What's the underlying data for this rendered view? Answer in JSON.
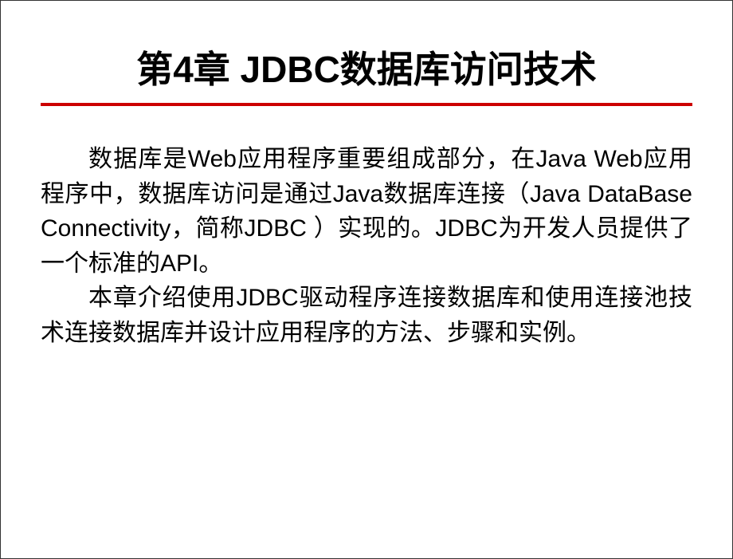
{
  "slide": {
    "title": "第4章  JDBC数据库访问技术",
    "paragraph1": "数据库是Web应用程序重要组成部分，在Java Web应用程序中，数据库访问是通过Java数据库连接（Java DataBase Connectivity，简称JDBC ）实现的。JDBC为开发人员提供了一个标准的API。",
    "paragraph2": "本章介绍使用JDBC驱动程序连接数据库和使用连接池技术连接数据库并设计应用程序的方法、步骤和实例。"
  }
}
